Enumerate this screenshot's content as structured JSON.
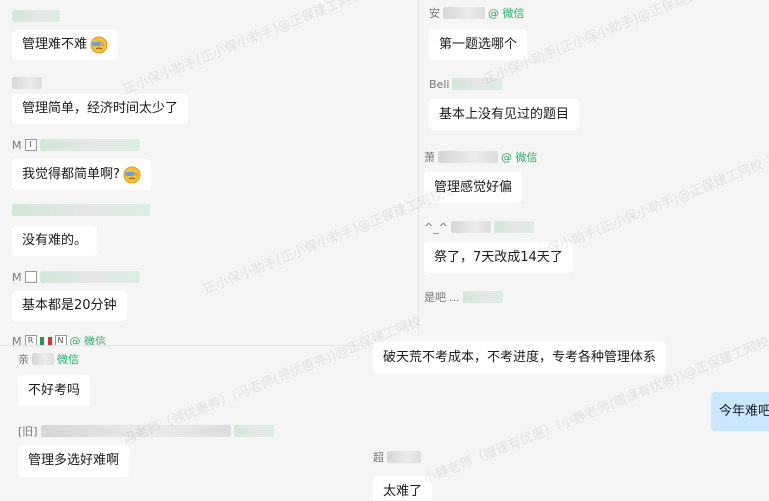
{
  "left_panel": {
    "messages": [
      {
        "sender_prefix": "",
        "sender_suffix": "",
        "text": "管理难不难",
        "emoji": "facepalm-emoji"
      },
      {
        "sender_prefix": "",
        "sender_suffix": "",
        "text": "管理简单，经济时间太少了"
      },
      {
        "sender_prefix": "M",
        "sender_suffix": "",
        "text": "我觉得都简单啊?",
        "emoji": "facepalm-emoji"
      },
      {
        "sender_prefix": "",
        "sender_suffix": "",
        "text": "没有难的。"
      },
      {
        "sender_prefix": "M",
        "sender_suffix": "",
        "text": "基本都是20分钟"
      },
      {
        "sender_prefix": "M",
        "sender_suffix": "@ 微信",
        "text": ""
      }
    ]
  },
  "left_bottom_panel": {
    "messages": [
      {
        "sender_prefix": "亲",
        "sender_suffix": "微信",
        "text": "不好考吗"
      },
      {
        "sender_prefix": "[旧]",
        "sender_suffix": "",
        "text": "管理多选好难啊"
      }
    ]
  },
  "right_panel": {
    "messages": [
      {
        "sender_prefix": "安",
        "sender_suffix": "@ 微信",
        "text": "第一题选哪个"
      },
      {
        "sender_prefix": "Beli",
        "sender_suffix": "",
        "text": "基本上没有见过的题目"
      },
      {
        "sender_prefix": "萧",
        "sender_suffix": "@ 微信",
        "text": "管理感觉好偏"
      },
      {
        "sender_prefix": "^_^",
        "sender_suffix": "",
        "text": "祭了，7天改成14天了"
      },
      {
        "sender_prefix": "是吧",
        "sender_suffix": "...",
        "text": ""
      }
    ]
  },
  "bottom_panel": {
    "messages": [
      {
        "sender_prefix": "",
        "sender_suffix": "",
        "text": "破天荒不考成本，不考进度，专考各种管理体系"
      },
      {
        "sender_prefix": "超",
        "sender_suffix": "",
        "text": "太难了"
      }
    ],
    "my_message": {
      "text": "今年难吧"
    }
  },
  "watermarks": [
    "正小保小助手(正小保小助手)@正保建工网校 2589",
    "冯老师（领优惠券）(冯老师(领优惠券))@正保建工网校",
    "小静老师（赠课有优惠）(小静老师(赠课有优惠))@正保建工网校"
  ],
  "colors": {
    "background": "#f5f5f5",
    "bubble": "#ffffff",
    "my_bubble": "#c9e7ff",
    "wechat_green": "#2aae67"
  }
}
